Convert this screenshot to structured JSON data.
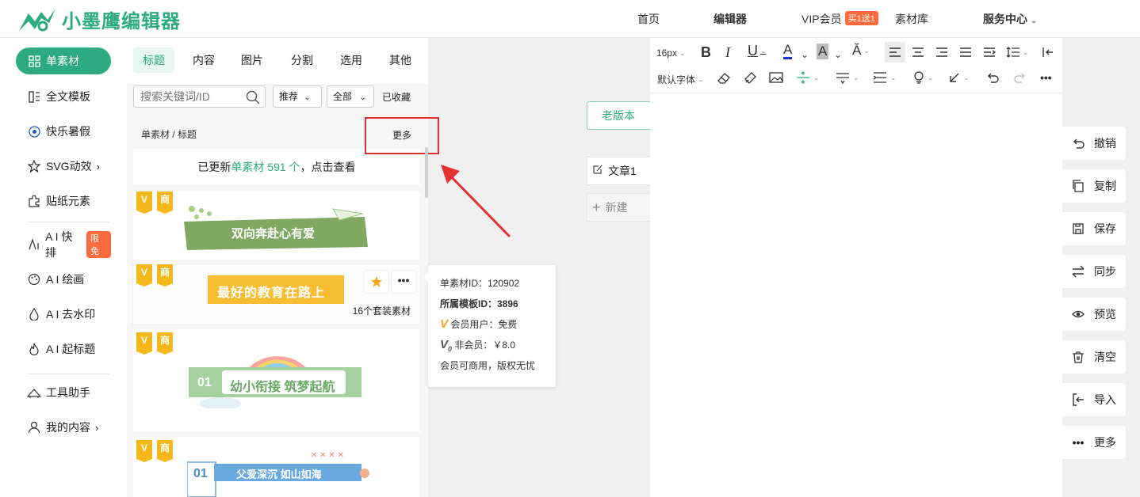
{
  "header": {
    "logo_text": "小墨鹰编辑器",
    "nav": {
      "home": "首页",
      "editor": "编辑器",
      "vip": "VIP会员",
      "vip_badge": "买1送1",
      "library": "素材库",
      "service": "服务中心"
    }
  },
  "sidebar": {
    "items": [
      {
        "label": "单素材"
      },
      {
        "label": "全文模板"
      },
      {
        "label": "快乐暑假"
      },
      {
        "label": "SVG动效"
      },
      {
        "label": "贴纸元素"
      },
      {
        "label": "A I 快排",
        "badge": "限免"
      },
      {
        "label": "A I 绘画"
      },
      {
        "label": "A I 去水印"
      },
      {
        "label": "A I 起标题"
      },
      {
        "label": "工具助手"
      },
      {
        "label": "我的内容"
      }
    ]
  },
  "panel": {
    "tabs": [
      "标题",
      "内容",
      "图片",
      "分割",
      "选用",
      "其他"
    ],
    "search_placeholder": "搜索关键词/ID",
    "sort": "推荐",
    "filter": "全部",
    "favorites": "已收藏",
    "breadcrumb": "单素材 / 标题",
    "more": "更多",
    "updated_prefix": "已更新",
    "updated_highlight": "单素材 591 个",
    "updated_suffix": "，点击查看",
    "cards": [
      {
        "text": "双向奔赴心有爱"
      },
      {
        "text": "最好的教育在路上",
        "set_label": "16个套装素材"
      },
      {
        "text": "幼小衔接 筑梦起航",
        "number": "01"
      },
      {
        "text": "父爱深沉 如山如海",
        "number": "01"
      }
    ],
    "tag_v": "V",
    "tag_shang": "商"
  },
  "tooltip": {
    "id_line": "单素材ID：120902",
    "template_line": "所属模板ID：3896",
    "member_line": "会员用户：免费",
    "nonmember_line": "非会员：￥8.0",
    "license_line": "会员可商用，版权无忧"
  },
  "middle": {
    "old_version": "老版本",
    "doc_name": "文章1",
    "new_doc": "新建"
  },
  "editor_toolbar": {
    "font_size": "16px",
    "font_family": "默认字体"
  },
  "actions": [
    "撤销",
    "复制",
    "保存",
    "同步",
    "预览",
    "清空",
    "导入",
    "更多"
  ],
  "colors": {
    "brand": "#2daa82",
    "badge": "#ff6b3d",
    "highlight_box": "#e03030"
  }
}
